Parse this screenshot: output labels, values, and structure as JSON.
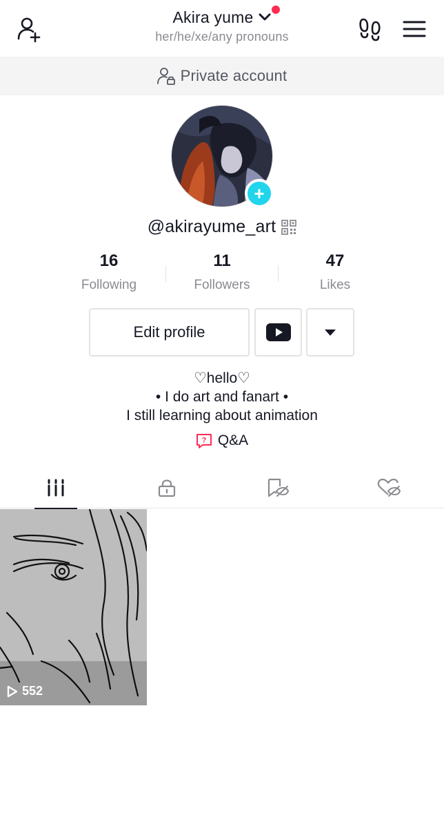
{
  "header": {
    "display_name": "Akira yume",
    "pronouns": "her/he/xe/any pronouns",
    "icons": {
      "add_user": "add-user-icon",
      "footprint": "footprint-icon",
      "menu": "hamburger-menu-icon",
      "chevron": "chevron-down-icon"
    },
    "notification_color": "#fe2c55"
  },
  "private_banner": {
    "text": "Private account",
    "icon": "person-lock-icon"
  },
  "profile": {
    "username": "@akirayume_art",
    "avatar_badge": "+",
    "avatar_badge_color": "#20d5ec"
  },
  "stats": [
    {
      "value": "16",
      "label": "Following"
    },
    {
      "value": "11",
      "label": "Followers"
    },
    {
      "value": "47",
      "label": "Likes"
    }
  ],
  "actions": {
    "edit_profile": "Edit profile",
    "youtube_icon": "youtube-icon",
    "dropdown_icon": "caret-down-icon"
  },
  "bio": {
    "lines": [
      "♡hello♡",
      "• I do art and fanart •",
      "I still learning about animation"
    ],
    "qa_label": "Q&A",
    "qa_color": "#fe2c55"
  },
  "tabs": [
    {
      "name": "videos",
      "icon": "grid-icon",
      "active": true
    },
    {
      "name": "private",
      "icon": "lock-icon",
      "active": false
    },
    {
      "name": "favorites",
      "icon": "bookmark-hidden-icon",
      "active": false
    },
    {
      "name": "liked",
      "icon": "heart-hidden-icon",
      "active": false
    }
  ],
  "videos": [
    {
      "views": "552"
    }
  ]
}
